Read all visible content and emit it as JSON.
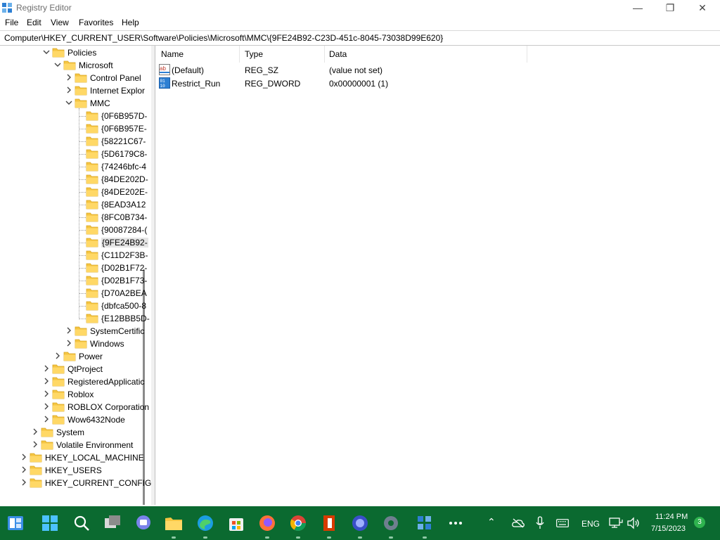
{
  "window": {
    "title": "Registry Editor",
    "minimize_glyph": "—",
    "maximize_glyph": "❐",
    "close_glyph": "✕"
  },
  "menu": [
    "File",
    "Edit",
    "View",
    "Favorites",
    "Help"
  ],
  "address": "Computer\\HKEY_CURRENT_USER\\Software\\Policies\\Microsoft\\MMC\\{9FE24B92-C23D-451c-8045-73038D99E620}",
  "tree": [
    {
      "label": "Policies",
      "level": 1,
      "expander": "expanded"
    },
    {
      "label": "Microsoft",
      "level": 2,
      "expander": "expanded"
    },
    {
      "label": "Control Panel",
      "level": 3,
      "expander": "collapsed"
    },
    {
      "label": "Internet Explor",
      "level": 3,
      "expander": "collapsed"
    },
    {
      "label": "MMC",
      "level": 3,
      "expander": "expanded"
    },
    {
      "label": "{0F6B957D-",
      "level": 4,
      "expander": "none"
    },
    {
      "label": "{0F6B957E-",
      "level": 4,
      "expander": "none"
    },
    {
      "label": "{58221C67-",
      "level": 4,
      "expander": "none"
    },
    {
      "label": "{5D6179C8-",
      "level": 4,
      "expander": "none"
    },
    {
      "label": "{74246bfc-4",
      "level": 4,
      "expander": "none"
    },
    {
      "label": "{84DE202D-",
      "level": 4,
      "expander": "none"
    },
    {
      "label": "{84DE202E-",
      "level": 4,
      "expander": "none"
    },
    {
      "label": "{8EAD3A12",
      "level": 4,
      "expander": "none"
    },
    {
      "label": "{8FC0B734-",
      "level": 4,
      "expander": "none"
    },
    {
      "label": "{90087284-(",
      "level": 4,
      "expander": "none"
    },
    {
      "label": "{9FE24B92-",
      "level": 4,
      "expander": "none",
      "selected": true
    },
    {
      "label": "{C11D2F3B-",
      "level": 4,
      "expander": "none"
    },
    {
      "label": "{D02B1F72-",
      "level": 4,
      "expander": "none"
    },
    {
      "label": "{D02B1F73-",
      "level": 4,
      "expander": "none"
    },
    {
      "label": "{D70A2BEA",
      "level": 4,
      "expander": "none"
    },
    {
      "label": "{dbfca500-8",
      "level": 4,
      "expander": "none"
    },
    {
      "label": "{E12BBB5D-",
      "level": 4,
      "expander": "none"
    },
    {
      "label": "SystemCertific",
      "level": 3,
      "expander": "collapsed"
    },
    {
      "label": "Windows",
      "level": 3,
      "expander": "collapsed"
    },
    {
      "label": "Power",
      "level": 2,
      "expander": "collapsed"
    },
    {
      "label": "QtProject",
      "level": 1,
      "expander": "collapsed"
    },
    {
      "label": "RegisteredApplicatic",
      "level": 1,
      "expander": "collapsed"
    },
    {
      "label": "Roblox",
      "level": 1,
      "expander": "collapsed"
    },
    {
      "label": "ROBLOX Corporation",
      "level": 1,
      "expander": "collapsed"
    },
    {
      "label": "Wow6432Node",
      "level": 1,
      "expander": "collapsed"
    },
    {
      "label": "System",
      "level": 0,
      "expander": "collapsed"
    },
    {
      "label": "Volatile Environment",
      "level": 0,
      "expander": "collapsed"
    },
    {
      "label": "HKEY_LOCAL_MACHINE",
      "level": -1,
      "expander": "collapsed"
    },
    {
      "label": "HKEY_USERS",
      "level": -1,
      "expander": "collapsed"
    },
    {
      "label": "HKEY_CURRENT_CONFIG",
      "level": -1,
      "expander": "collapsed"
    }
  ],
  "list": {
    "columns": [
      "Name",
      "Type",
      "Data"
    ],
    "rows": [
      {
        "name": "(Default)",
        "type": "REG_SZ",
        "data": "(value not set)",
        "icon": "string-value-icon"
      },
      {
        "name": "Restrict_Run",
        "type": "REG_DWORD",
        "data": "0x00000001 (1)",
        "icon": "binary-value-icon"
      }
    ]
  },
  "taskbar": {
    "apps": [
      {
        "name": "widgets-icon"
      },
      {
        "name": "start-icon"
      },
      {
        "name": "search-icon"
      },
      {
        "name": "task-view-icon"
      },
      {
        "name": "chat-icon"
      },
      {
        "name": "file-explorer-icon"
      },
      {
        "name": "edge-icon"
      },
      {
        "name": "store-icon"
      },
      {
        "name": "firefox-icon"
      },
      {
        "name": "chrome-icon"
      },
      {
        "name": "office-icon"
      },
      {
        "name": "network-app-icon"
      },
      {
        "name": "settings-icon"
      },
      {
        "name": "registry-editor-icon"
      },
      {
        "name": "more-icon"
      }
    ],
    "tray": {
      "language": "ENG",
      "time": "11:24 PM",
      "date": "7/15/2023",
      "notification_count": "3"
    }
  },
  "colors": {
    "taskbar_bg": "#0b6a30",
    "folder": "#f5c542",
    "selection": "#e5e5e5",
    "notification_badge": "#2fb34f"
  }
}
